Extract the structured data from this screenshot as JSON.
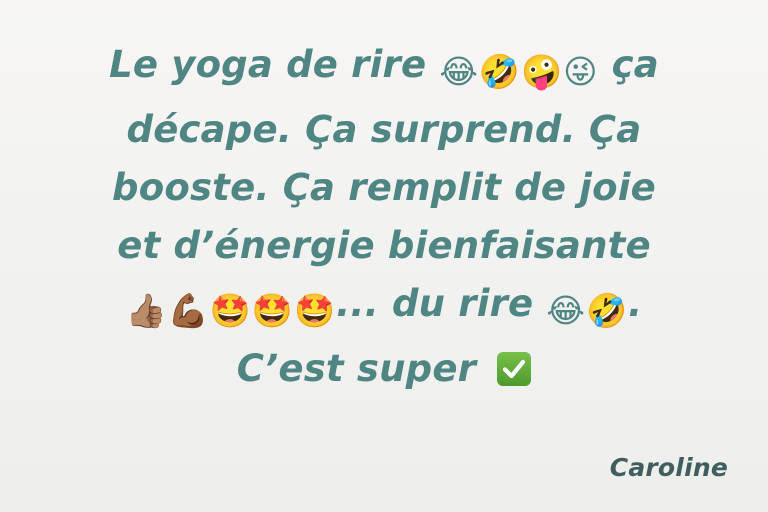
{
  "quote": {
    "line1_text": "Le yoga de rire",
    "line1_emojis": "😂🤣🤪😜",
    "line1_tail": "ça",
    "line2_text": "décape. Ça surprend. Ça",
    "line3_text": "booste. Ça remplit de joie",
    "line4_text": "et d’énergie bienfaisante",
    "line5_emojis_lead": "👍🏽💪🏾🤩🤩🤩",
    "line5_text": "... du rire",
    "line5_emojis_tail": "😂🤣",
    "line5_end": ".",
    "line6_text": "C’est super",
    "line6_icon": "check-mark-button-icon"
  },
  "signature": {
    "name": "Caroline"
  },
  "colors": {
    "text": "#4f8583",
    "signature": "#3f5f5e",
    "check_green": "#5aa534"
  }
}
